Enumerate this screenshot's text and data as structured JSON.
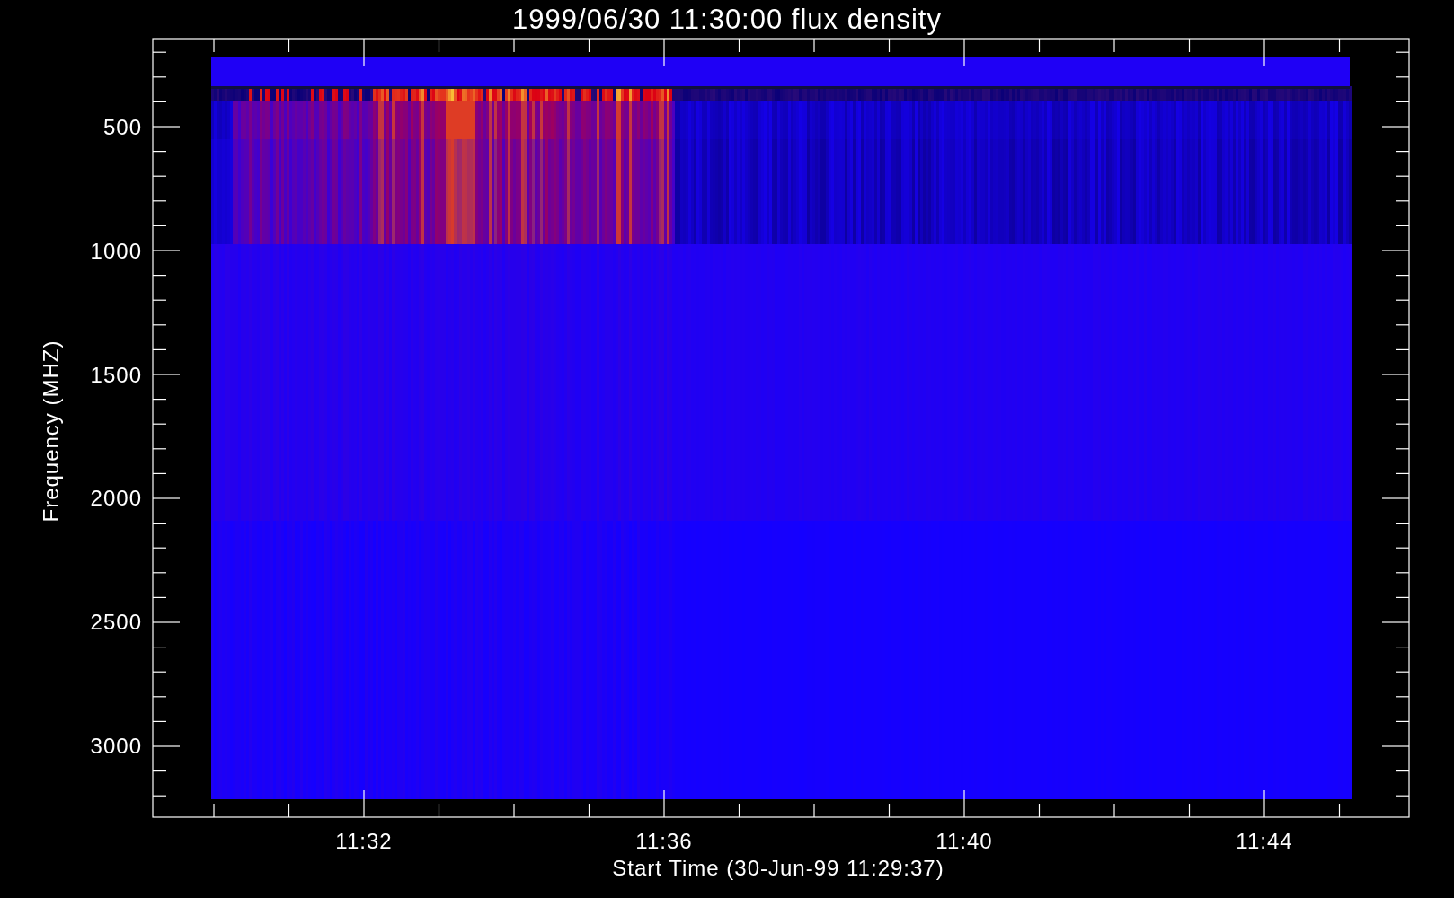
{
  "title": "1999/06/30 11:30:00 flux density",
  "y_axis": {
    "label": "Frequency (MHZ)",
    "ticks": [
      "500",
      "1000",
      "1500",
      "2000",
      "2500",
      "3000"
    ]
  },
  "x_axis": {
    "label": "Start Time (30-Jun-99 11:29:37)",
    "ticks": [
      "11:32",
      "11:36",
      "11:40",
      "11:44"
    ]
  }
}
